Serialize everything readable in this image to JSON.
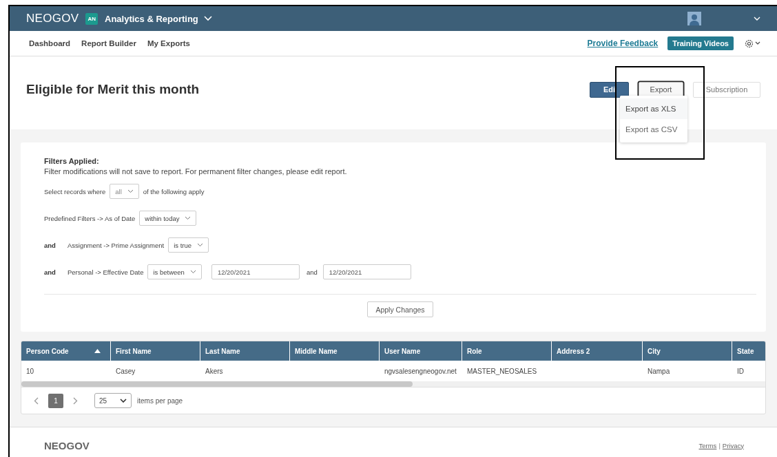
{
  "header": {
    "brand": "NEOGOV",
    "app_badge": "AN",
    "app_name": "Analytics & Reporting"
  },
  "nav": {
    "items": [
      {
        "label": "Dashboard"
      },
      {
        "label": "Report Builder"
      },
      {
        "label": "My Exports"
      }
    ],
    "feedback_link": "Provide Feedback",
    "training_button": "Training Videos"
  },
  "report": {
    "title": "Eligible for Merit this month",
    "buttons": [
      {
        "label": "Edi",
        "kind": "primary"
      },
      {
        "label": "Export",
        "kind": "focused"
      },
      {
        "label": "Subscription",
        "kind": "outline"
      }
    ],
    "export_menu": [
      {
        "label": "Export as XLS",
        "selected": true
      },
      {
        "label": "Export as CSV",
        "selected": false
      }
    ]
  },
  "filters": {
    "heading": "Filters Applied:",
    "note": "Filter modifications will not save to report. For permanent filter changes, please edit report.",
    "match": {
      "prefix": "Select records where",
      "value": "all",
      "suffix": "of the following apply"
    },
    "rows": [
      {
        "field": "Predefined Filters -> As of Date",
        "operator": "within today"
      },
      {
        "conjunction": "and",
        "field": "Assignment -> Prime Assignment",
        "operator": "is true"
      },
      {
        "conjunction": "and",
        "field": "Personal -> Effective Date",
        "operator": "is between",
        "from": "12/20/2021",
        "joiner": "and",
        "to": "12/20/2021"
      }
    ],
    "apply_button": "Apply Changes"
  },
  "table": {
    "columns": [
      {
        "label": "Person Code",
        "sorted": true
      },
      {
        "label": "First Name",
        "sorted": false
      },
      {
        "label": "Last Name",
        "sorted": false
      },
      {
        "label": "Middle Name",
        "sorted": false
      },
      {
        "label": "User Name",
        "sorted": false
      },
      {
        "label": "Role",
        "sorted": false
      },
      {
        "label": "Address 2",
        "sorted": false
      },
      {
        "label": "City",
        "sorted": false
      },
      {
        "label": "State",
        "sorted": false
      }
    ],
    "rows": [
      [
        "10",
        "Casey",
        "Akers",
        null,
        "ngvsalesengneogov.net",
        "MASTER_NEOSALES",
        null,
        "Nampa",
        "ID"
      ]
    ]
  },
  "pagination": {
    "pages": [
      {
        "label": "1",
        "selected": true
      }
    ],
    "page_size": "25",
    "page_size_label": "items per page"
  },
  "footer": {
    "brand": "NEOGOV",
    "links": [
      "Terms",
      "Privacy"
    ],
    "separator": "|"
  }
}
